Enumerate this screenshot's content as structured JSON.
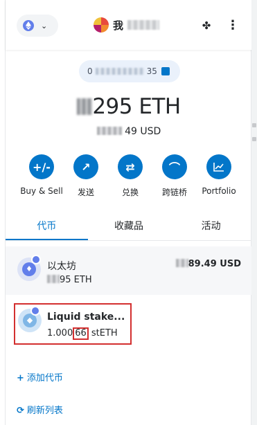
{
  "header": {
    "network_icon": "eth-icon",
    "account_name": "我",
    "menu_icon": "more-vertical-icon"
  },
  "address": {
    "prefix": "0",
    "suffix": "35"
  },
  "balance": {
    "eth_value": "295 ETH",
    "fiat_value": "49 USD"
  },
  "actions": [
    {
      "label": "Buy & Sell",
      "icon": "+/-"
    },
    {
      "label": "发送",
      "icon": "↗"
    },
    {
      "label": "兑换",
      "icon": "⇄"
    },
    {
      "label": "跨链桥",
      "icon": "⌒"
    },
    {
      "label": "Portfolio",
      "icon": "📈"
    }
  ],
  "tabs": [
    "代币",
    "收藏品",
    "活动"
  ],
  "tokens": [
    {
      "name": "以太坊",
      "amount": "95 ETH",
      "fiat": "89.49 USD"
    },
    {
      "name": "Liquid stake...",
      "amount_pre": "1.000",
      "amount_hl": "66",
      "amount_post": " stETH"
    }
  ],
  "links": {
    "add_token": "添加代币",
    "refresh": "刷新列表"
  },
  "colors": {
    "accent": "#0376c9",
    "highlight": "#d32f2f"
  }
}
